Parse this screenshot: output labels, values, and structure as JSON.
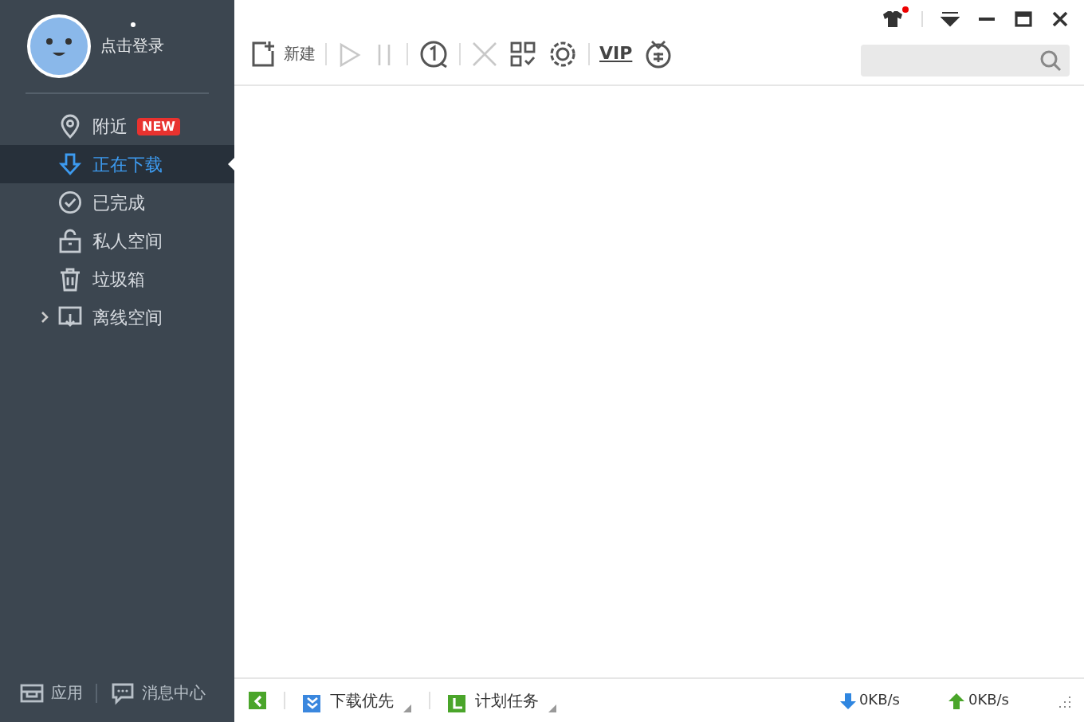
{
  "user": {
    "login": "点击登录",
    "notice": true
  },
  "sidebar": {
    "items": [
      {
        "label": "附近",
        "badge": "NEW",
        "selected": false
      },
      {
        "label": "正在下载",
        "selected": true
      },
      {
        "label": "已完成",
        "selected": false
      },
      {
        "label": "私人空间",
        "selected": false
      },
      {
        "label": "垃圾箱",
        "selected": false
      },
      {
        "label": "离线空间",
        "selected": false,
        "expanded": false
      }
    ],
    "footer": [
      {
        "label": "应用"
      },
      {
        "label": "消息中心"
      }
    ]
  },
  "toolbar": [
    {
      "kind": "new",
      "label": "新建"
    },
    {
      "kind": "sep"
    },
    {
      "kind": "start",
      "disabled": true
    },
    {
      "kind": "pause",
      "disabled": true
    },
    {
      "kind": "sep"
    },
    {
      "kind": "limit",
      "disabled": false
    },
    {
      "kind": "sep"
    },
    {
      "kind": "delete",
      "disabled": true
    },
    {
      "kind": "grid",
      "disabled": false
    },
    {
      "kind": "settings",
      "disabled": false
    },
    {
      "kind": "sep"
    },
    {
      "kind": "vip",
      "label": "VIP"
    },
    {
      "kind": "gift",
      "disabled": false
    }
  ],
  "titlebar": {
    "skin_notice": true
  },
  "status_bar": {
    "priority": "下载优先",
    "schedule": "计划任务",
    "down_speed": "0KB/s",
    "up_speed": "0KB/s"
  }
}
